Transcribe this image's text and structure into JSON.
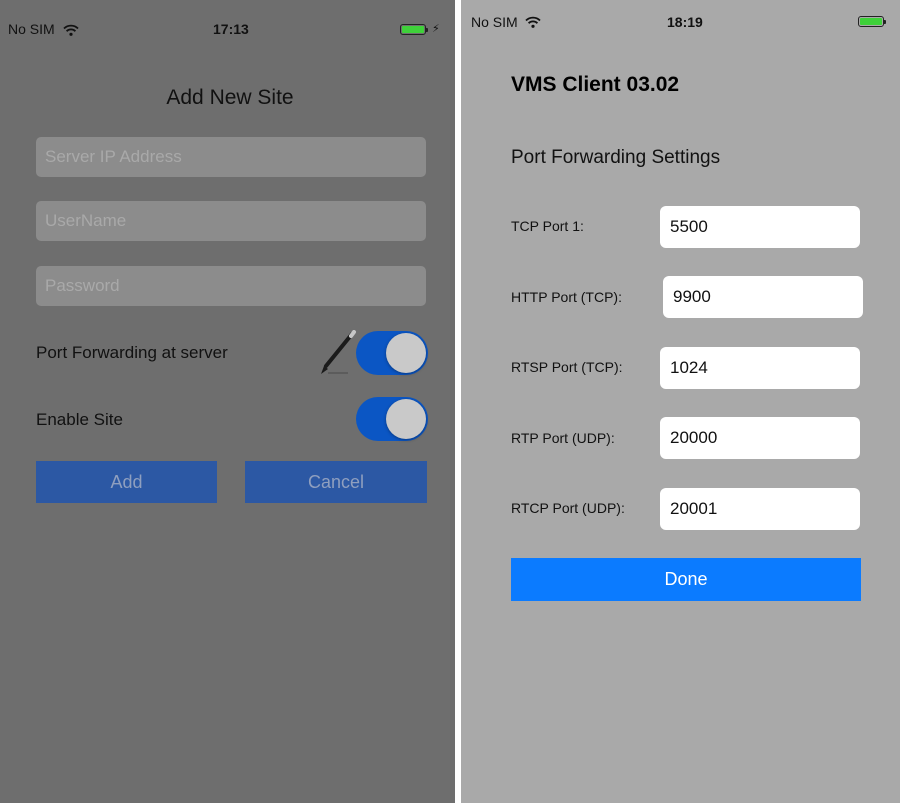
{
  "left_screen": {
    "status_bar": {
      "carrier": "No SIM",
      "time": "17:13"
    },
    "title": "Add New Site",
    "fields": {
      "server_ip": {
        "placeholder": "Server IP Address",
        "value": ""
      },
      "username": {
        "placeholder": "UserName",
        "value": ""
      },
      "password": {
        "placeholder": "Password",
        "value": ""
      }
    },
    "port_forwarding": {
      "label": "Port Forwarding at server",
      "on": true,
      "icon": "pencil-icon"
    },
    "enable_site": {
      "label": "Enable Site",
      "on": true
    },
    "buttons": {
      "add": "Add",
      "cancel": "Cancel"
    }
  },
  "right_screen": {
    "status_bar": {
      "carrier": "No SIM",
      "time": "18:19"
    },
    "title": "VMS Client 03.02",
    "subtitle": "Port Forwarding Settings",
    "ports": [
      {
        "label": "TCP Port 1:",
        "value": "5500"
      },
      {
        "label": "HTTP Port (TCP):",
        "value": "9900"
      },
      {
        "label": "RTSP Port (TCP):",
        "value": "1024"
      },
      {
        "label": "RTP Port (UDP):",
        "value": "20000"
      },
      {
        "label": "RTCP Port (UDP):",
        "value": "20001"
      }
    ],
    "done_label": "Done"
  },
  "colors": {
    "toggle_on": "#0b56c4",
    "left_button": "#2c58a4",
    "done_button": "#0b7bff",
    "battery": "#3fd13a"
  }
}
